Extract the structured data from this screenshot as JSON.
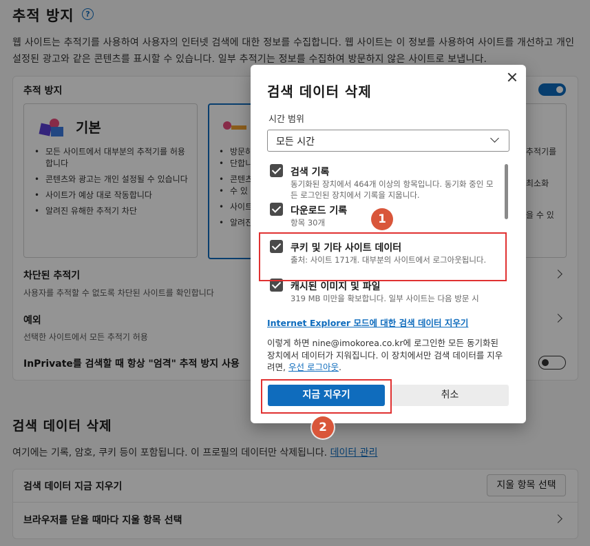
{
  "settings": {
    "title": "추적 방지",
    "help": "?",
    "description": "웹 사이트는 추적기를 사용하여 사용자의 인터넷 검색에 대한 정보를 수집합니다. 웹 사이트는 이 정보를 사용하여 사이트를 개선하고 개인 설정된 광고와 같은 콘텐츠를 표시할 수 있습니다. 일부 추적기는 정보를 수집하여 방문하지 않은 사이트로 보냅니다.",
    "card_label": "추적 방지",
    "options": [
      {
        "title": "기본",
        "bullets": [
          "모든 사이트에서 대부분의 추적기를 허용합니다",
          "콘텐츠와 광고는 개인 설정될 수 있습니다",
          "사이트가 예상 대로 작동합니다",
          "알려진 유해한 추적기 차단"
        ]
      },
      {
        "bullets": [
          "방문하",
          "단합니",
          "콘텐츠",
          "수 있",
          "사이트",
          "알려진"
        ]
      },
      {
        "bullets": [
          "추적기를",
          "",
          "최소화",
          "",
          "을 수 있"
        ]
      }
    ],
    "blocked": {
      "title": "차단된 추적기",
      "sub": "사용자를 추적할 수 없도록 차단된 사이트를 확인합니다"
    },
    "exceptions": {
      "title": "예외",
      "sub": "선택한 사이트에서 모든 추적기 허용"
    },
    "inprivate": "InPrivate를 검색할 때 항상 \"엄격\" 추적 방지 사용",
    "clear_section": {
      "title": "검색 데이터 삭제",
      "desc": "여기에는 기록, 암호, 쿠키 등이 포함됩니다. 이 프로필의 데이터만 삭제됩니다.",
      "manage_link": "데이터 관리",
      "now_label": "검색 데이터 지금 지우기",
      "select_button": "지울 항목 선택",
      "on_close_label": "브라우저를 닫을 때마다 지울 항목 선택"
    }
  },
  "dialog": {
    "title": "검색 데이터 삭제",
    "range_label": "시간 범위",
    "range_value": "모든 시간",
    "items": [
      {
        "title": "검색 기록",
        "sub": "동기화된 장치에서 464개 이상의 항목입니다. 동기화 중인 모든 로그인된 장치에서 기록을 지웁니다.",
        "checked": true
      },
      {
        "title": "다운로드 기록",
        "sub": "항목 30개",
        "checked": true
      },
      {
        "title": "쿠키 및 기타 사이트 데이터",
        "sub": "출처: 사이트 171개. 대부분의 사이트에서 로그아웃됩니다.",
        "checked": true
      },
      {
        "title": "캐시된 이미지 및 파일",
        "sub": "319 MB 미만을 확보합니다. 일부 사이트는 다음 방문 시",
        "checked": true
      }
    ],
    "ie_link": "Internet Explorer 모드에 대한 검색 데이터 지우기",
    "info_text": "이렇게 하면 nine@imokorea.co.kr에 로그인한 모든 동기화된 장치에서 데이터가 지워집니다. 이 장치에서만 검색 데이터를 지우려면,",
    "signout_link": "우선 로그아웃",
    "info_end": ".",
    "clear_button": "지금 지우기",
    "cancel_button": "취소"
  },
  "annotations": {
    "badge1": "1",
    "badge2": "2",
    "highlight_color": "#e03030",
    "badge_color": "#d9563a"
  },
  "colors": {
    "accent": "#0f6cbd"
  }
}
